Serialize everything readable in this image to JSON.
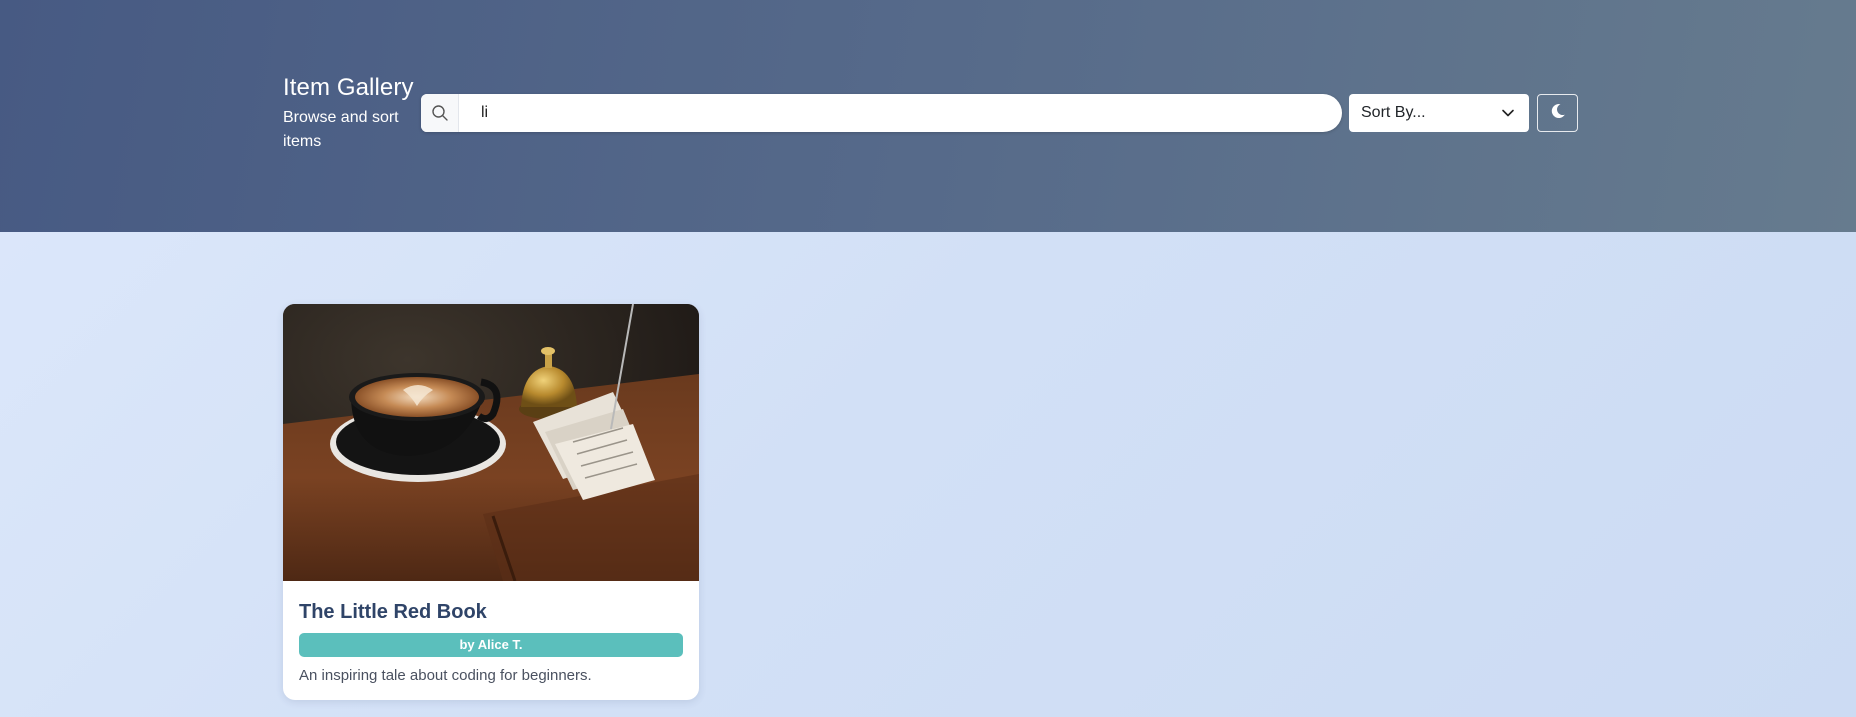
{
  "header": {
    "title": "Item Gallery",
    "subtitle": "Browse and sort items",
    "search": {
      "value": "li",
      "icon": "search-icon"
    },
    "sort": {
      "selected": "Sort By..."
    },
    "theme_toggle": {
      "icon": "moon-icon"
    }
  },
  "items": [
    {
      "title": "The Little Red Book",
      "author": "by Alice T.",
      "description": "An inspiring tale about coding for beginners.",
      "image": "coffee-cup-photo"
    }
  ],
  "colors": {
    "header_gradient_start": "#475a83",
    "header_gradient_end": "#667b8e",
    "page_background": "#d6e3f8",
    "card_title": "#2f4468",
    "author_badge": "#5bbfbc"
  }
}
